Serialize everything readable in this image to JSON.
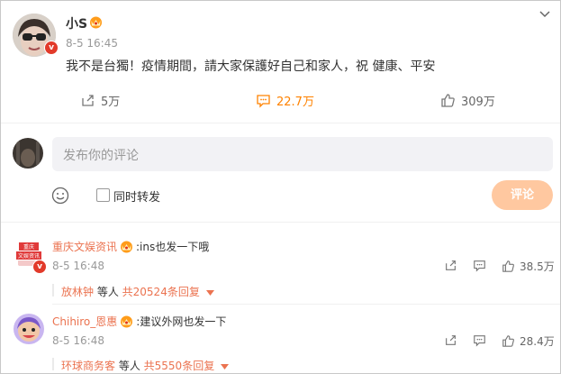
{
  "post": {
    "author": "小S",
    "time": "8-5 16:45",
    "content": "我不是台獨！疫情期間，請大家保護好自己和家人，祝 健康、平安",
    "reposts": "5万",
    "comments": "22.7万",
    "likes": "309万"
  },
  "composer": {
    "placeholder": "发布你的评论",
    "repost_label": "同时转发",
    "submit_label": "评论"
  },
  "comments": [
    {
      "name": "重庆文娱资讯",
      "avatar_text": "重庆文娱资讯",
      "text": ":ins也发一下哦",
      "time": "8-5 16:48",
      "likes": "38.5万",
      "reply_user": "放林钟",
      "reply_mid": " 等人 ",
      "reply_count": "共20524条回复"
    },
    {
      "name": "Chihiro_恩惠",
      "text": ":建议外网也发一下",
      "time": "8-5 16:48",
      "likes": "28.4万",
      "reply_user": "环球商务客",
      "reply_mid": " 等人 ",
      "reply_count": "共5550条回复"
    }
  ],
  "icons": [
    "chevron-down-icon",
    "verified-icon",
    "crown-icon",
    "repost-icon",
    "comment-icon",
    "like-icon",
    "emoji-icon"
  ],
  "colors": {
    "accent": "#ff8200",
    "link": "#eb7350",
    "submit": "#ffc8a0",
    "verified": "#e23a2a"
  }
}
